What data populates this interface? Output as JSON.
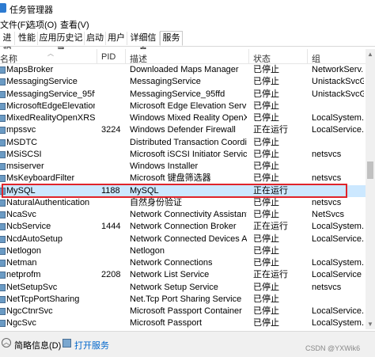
{
  "window": {
    "title": "任务管理器"
  },
  "menu": {
    "items": [
      "文件(F)",
      "选项(O)",
      "查看(V)"
    ]
  },
  "tabs": [
    {
      "label": "进程",
      "active": false
    },
    {
      "label": "性能",
      "active": false
    },
    {
      "label": "应用历史记录",
      "active": false
    },
    {
      "label": "启动",
      "active": false
    },
    {
      "label": "用户",
      "active": false
    },
    {
      "label": "详细信息",
      "active": false
    },
    {
      "label": "服务",
      "active": true
    }
  ],
  "columns": {
    "name": "名称",
    "pid": "PID",
    "description": "描述",
    "status": "状态",
    "group": "组"
  },
  "services": [
    {
      "name": "MapsBroker",
      "pid": "",
      "description": "Downloaded Maps Manager",
      "status": "已停止",
      "group": "NetworkServ..."
    },
    {
      "name": "MessagingService",
      "pid": "",
      "description": "MessagingService",
      "status": "已停止",
      "group": "UnistackSvcG..."
    },
    {
      "name": "MessagingService_95ffd",
      "pid": "",
      "description": "MessagingService_95ffd",
      "status": "已停止",
      "group": "UnistackSvcG..."
    },
    {
      "name": "MicrosoftEdgeElevationS...",
      "pid": "",
      "description": "Microsoft Edge Elevation Service...",
      "status": "已停止",
      "group": ""
    },
    {
      "name": "MixedRealityOpenXRSvc",
      "pid": "",
      "description": "Windows Mixed Reality OpenXR ...",
      "status": "已停止",
      "group": "LocalSystem..."
    },
    {
      "name": "mpssvc",
      "pid": "3224",
      "description": "Windows Defender Firewall",
      "status": "正在运行",
      "group": "LocalService..."
    },
    {
      "name": "MSDTC",
      "pid": "",
      "description": "Distributed Transaction Coordina...",
      "status": "已停止",
      "group": ""
    },
    {
      "name": "MSiSCSI",
      "pid": "",
      "description": "Microsoft iSCSI Initiator Service",
      "status": "已停止",
      "group": "netsvcs"
    },
    {
      "name": "msiserver",
      "pid": "",
      "description": "Windows Installer",
      "status": "已停止",
      "group": ""
    },
    {
      "name": "MsKeyboardFilter",
      "pid": "",
      "description": "Microsoft 键盘筛选器",
      "status": "已停止",
      "group": "netsvcs"
    },
    {
      "name": "MySQL",
      "pid": "1188",
      "description": "MySQL",
      "status": "正在运行",
      "group": "",
      "selected": true
    },
    {
      "name": "NaturalAuthentication",
      "pid": "",
      "description": "自然身份验证",
      "status": "已停止",
      "group": "netsvcs"
    },
    {
      "name": "NcaSvc",
      "pid": "",
      "description": "Network Connectivity Assistant",
      "status": "已停止",
      "group": "NetSvcs"
    },
    {
      "name": "NcbService",
      "pid": "1444",
      "description": "Network Connection Broker",
      "status": "正在运行",
      "group": "LocalSystem..."
    },
    {
      "name": "NcdAutoSetup",
      "pid": "",
      "description": "Network Connected Devices Aut...",
      "status": "已停止",
      "group": "LocalService..."
    },
    {
      "name": "Netlogon",
      "pid": "",
      "description": "Netlogon",
      "status": "已停止",
      "group": ""
    },
    {
      "name": "Netman",
      "pid": "",
      "description": "Network Connections",
      "status": "已停止",
      "group": "LocalSystem..."
    },
    {
      "name": "netprofm",
      "pid": "2208",
      "description": "Network List Service",
      "status": "正在运行",
      "group": "LocalService"
    },
    {
      "name": "NetSetupSvc",
      "pid": "",
      "description": "Network Setup Service",
      "status": "已停止",
      "group": "netsvcs"
    },
    {
      "name": "NetTcpPortSharing",
      "pid": "",
      "description": "Net.Tcp Port Sharing Service",
      "status": "已停止",
      "group": ""
    },
    {
      "name": "NgcCtnrSvc",
      "pid": "",
      "description": "Microsoft Passport Container",
      "status": "已停止",
      "group": "LocalService..."
    },
    {
      "name": "NgcSvc",
      "pid": "",
      "description": "Microsoft Passport",
      "status": "已停止",
      "group": "LocalSystem..."
    }
  ],
  "footer": {
    "less_details": "简略信息(D)",
    "open_services": "打开服务",
    "watermark": "CSDN @YXWik6"
  }
}
